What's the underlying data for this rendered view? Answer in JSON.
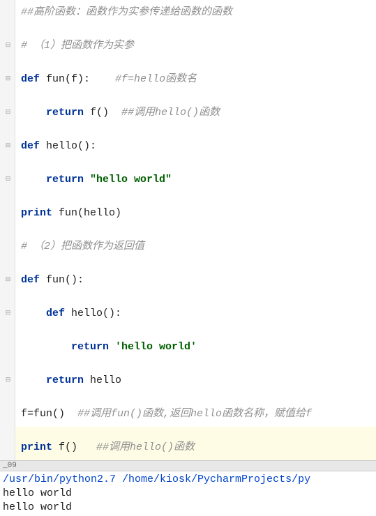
{
  "editor": {
    "lines": [
      {
        "type": "comment",
        "indent": 0,
        "full": "##高阶函数：函数作为实参传递给函数的函数",
        "fold": false
      },
      {
        "type": "blank",
        "indent": 0,
        "fold": false
      },
      {
        "type": "comment",
        "indent": 0,
        "full": "# （1）把函数作为实参",
        "fold": true
      },
      {
        "type": "blank",
        "indent": 0,
        "fold": false
      },
      {
        "type": "def",
        "indent": 0,
        "kw": "def",
        "name": "fun",
        "params": "(f):",
        "trail_comment": "    #f=hello函数名",
        "fold": true
      },
      {
        "type": "blank",
        "indent": 0,
        "fold": false
      },
      {
        "type": "return-call",
        "indent": 1,
        "kw": "return",
        "expr": "f()",
        "trail_comment": "  ##调用hello()函数",
        "fold": true
      },
      {
        "type": "blank",
        "indent": 0,
        "fold": false
      },
      {
        "type": "def",
        "indent": 0,
        "kw": "def",
        "name": "hello",
        "params": "():",
        "fold": true
      },
      {
        "type": "blank",
        "indent": 0,
        "fold": false
      },
      {
        "type": "return-str",
        "indent": 1,
        "kw": "return",
        "str": "\"hello world\"",
        "fold": true
      },
      {
        "type": "blank",
        "indent": 0,
        "fold": false
      },
      {
        "type": "print",
        "indent": 0,
        "kw": "print",
        "expr": "fun(hello)",
        "fold": false
      },
      {
        "type": "blank",
        "indent": 0,
        "fold": false
      },
      {
        "type": "comment",
        "indent": 0,
        "full": "# （2）把函数作为返回值",
        "fold": false
      },
      {
        "type": "blank",
        "indent": 0,
        "fold": false
      },
      {
        "type": "def",
        "indent": 0,
        "kw": "def",
        "name": "fun",
        "params": "():",
        "fold": true
      },
      {
        "type": "blank",
        "indent": 0,
        "fold": false
      },
      {
        "type": "def",
        "indent": 1,
        "kw": "def",
        "name": "hello",
        "params": "():",
        "fold": true
      },
      {
        "type": "blank",
        "indent": 0,
        "fold": false
      },
      {
        "type": "return-str",
        "indent": 2,
        "kw": "return",
        "str": "'hello world'",
        "fold": false
      },
      {
        "type": "blank",
        "indent": 0,
        "fold": false
      },
      {
        "type": "return-call",
        "indent": 1,
        "kw": "return",
        "expr": "hello",
        "fold": true
      },
      {
        "type": "blank",
        "indent": 0,
        "fold": false
      },
      {
        "type": "assign",
        "indent": 0,
        "expr": "f=fun()",
        "trail_comment": "  ##调用fun()函数,返回hello函数名称，赋值给f",
        "fold": false
      },
      {
        "type": "blank-hl",
        "indent": 0,
        "fold": false
      },
      {
        "type": "print-hl",
        "indent": 0,
        "kw": "print",
        "expr": "f()",
        "trail_comment": "   ##调用hello()函数",
        "fold": false
      }
    ]
  },
  "tab": {
    "label": "_09"
  },
  "console": {
    "cmd": "/usr/bin/python2.7 /home/kiosk/PycharmProjects/py",
    "out1": "hello world",
    "out2": "hello world"
  }
}
